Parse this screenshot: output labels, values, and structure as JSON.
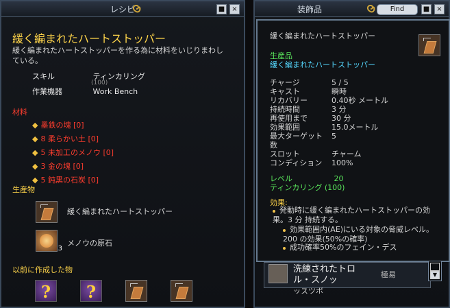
{
  "left_window": {
    "title": "レシピ",
    "header_title": "緩く編まれたハートストッパー",
    "description": "緩く編まれたハートストッパーを作る為に材料をいじりまわしている。",
    "skill_label": "スキル",
    "skill_value": "ティンカリング",
    "skill_overlap": "(100)",
    "device_label": "作業機器",
    "device_value": "Work Bench",
    "materials_label": "材料",
    "materials": [
      "墨鉄の塊 [0]",
      "8 柔らかい土 [0]",
      "5 未加工のメノウ [0]",
      "3 金の塊 [0]",
      "5 鈍黒の石炭 [0]"
    ],
    "products_label": "生産物",
    "products": [
      {
        "name": "緩く編まれたハートストッパー",
        "icon": "heart-stopper-icon"
      },
      {
        "name": "メノウの原石",
        "icon": "agate-ore-icon",
        "qty": "3"
      }
    ],
    "previous_label": "以前に作成した物",
    "previous_items": [
      {
        "icon": "question-icon"
      },
      {
        "icon": "question-icon"
      },
      {
        "icon": "heart-stopper-icon"
      },
      {
        "icon": "heart-stopper-icon"
      }
    ]
  },
  "right_window": {
    "title": "装飾品",
    "find_label": "Find",
    "tooltip": {
      "item_name": "緩く編まれたハートストッパー",
      "type_line1": "生産品",
      "type_line2": "緩く編まれたハートストッパー",
      "stats": [
        {
          "label": "チャージ",
          "value": "5 / 5"
        },
        {
          "label": "キャスト",
          "value": "瞬時"
        },
        {
          "label": "リカバリー",
          "value": "0.40秒 メートル"
        },
        {
          "label": "持続時間",
          "value": "3 分"
        },
        {
          "label": "再使用まで",
          "value": "30 分"
        },
        {
          "label": "効果範囲",
          "value": "15.0メートル"
        },
        {
          "label": "最大ターゲット",
          "value": "5"
        },
        {
          "label": "数",
          "value": ""
        },
        {
          "label": "スロット",
          "value": "チャーム"
        },
        {
          "label": "コンディション",
          "value": "100%"
        }
      ],
      "level_label": "レベル",
      "level_value": "20",
      "skill_req": "ティンカリング (100)",
      "effect_label": "効果:",
      "effect_main": "発動時に緩く編まれたハートストッパーの効果。3 分 持続する。",
      "effect_sub1": "効果範囲内(AE)にいる対象の脅威レベル。200 の効果(50%の確率)",
      "effect_sub2": "成功確率50%のフェイン・デス"
    },
    "bottom_item": {
      "name": "洗練されたトロル・スノッ",
      "difficulty": "極易",
      "overflow_text": "ッスツボ "
    }
  }
}
